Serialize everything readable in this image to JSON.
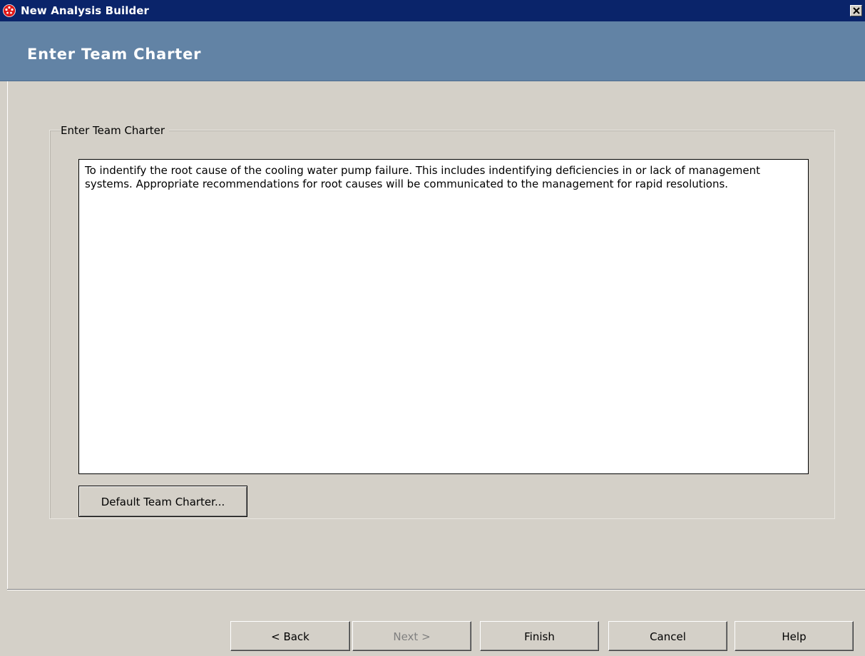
{
  "window": {
    "title": "New Analysis Builder"
  },
  "header": {
    "heading": "Enter Team Charter"
  },
  "charter": {
    "group_label": "Enter Team Charter",
    "text": "To indentify the root cause of the cooling water pump failure. This includes indentifying deficiencies in or lack of management systems. Appropriate recommendations for root causes will be communicated to the management for rapid resolutions.",
    "default_button_label": "Default Team Charter..."
  },
  "footer": {
    "back_label": "< Back",
    "next_label": "Next >",
    "next_enabled": false,
    "finish_label": "Finish",
    "cancel_label": "Cancel",
    "help_label": "Help"
  },
  "colors": {
    "titlebar": "#0a246a",
    "header_band": "#6283a5",
    "dialog_face": "#d4d0c8"
  }
}
